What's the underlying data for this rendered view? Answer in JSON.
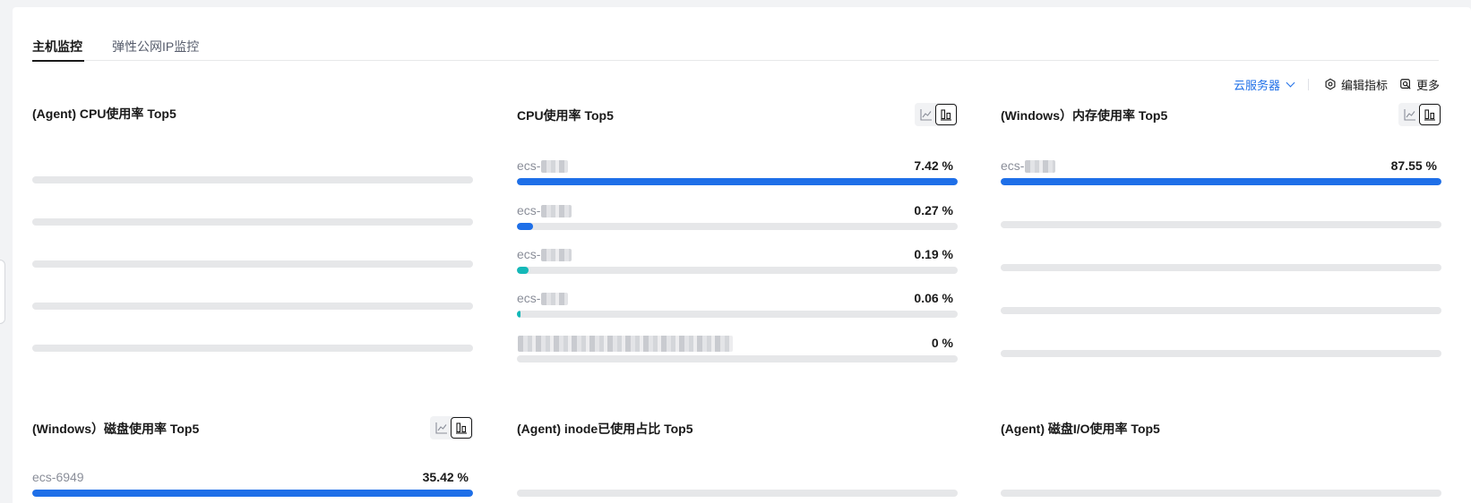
{
  "tabs": [
    {
      "label": "主机监控",
      "active": true
    },
    {
      "label": "弹性公网IP监控",
      "active": false
    }
  ],
  "toolbar": {
    "server_select": "云服务器",
    "edit_metrics": "编辑指标",
    "more": "更多"
  },
  "panels": {
    "agent_cpu": {
      "title": "(Agent) CPU使用率 Top5"
    },
    "cpu": {
      "title": "CPU使用率 Top5",
      "rows": [
        {
          "name": "ecs-",
          "value": "7.42 %",
          "fill_fraction": 1.0,
          "color": "#1e6fe8"
        },
        {
          "name": "ecs-",
          "value": "0.27 %",
          "fill_fraction": 0.036,
          "color": "#1e6fe8"
        },
        {
          "name": "ecs-",
          "value": "0.19 %",
          "fill_fraction": 0.026,
          "color": "#14b8b8"
        },
        {
          "name": "ecs-",
          "value": "0.06 %",
          "fill_fraction": 0.008,
          "color": "#14b8b8"
        },
        {
          "name": "",
          "value": "0 %",
          "fill_fraction": 0,
          "color": "#14b8b8"
        }
      ]
    },
    "win_mem": {
      "title": "(Windows）内存使用率 Top5",
      "rows": [
        {
          "name": "ecs-",
          "value": "87.55 %",
          "fill_fraction": 1.0,
          "color": "#1e6fe8"
        }
      ]
    },
    "win_disk": {
      "title": "(Windows）磁盘使用率 Top5",
      "rows": [
        {
          "name": "ecs-6949",
          "value": "35.42 %",
          "fill_fraction": 1.0,
          "color": "#1e6fe8"
        }
      ]
    },
    "agent_inode": {
      "title": "(Agent) inode已使用占比 Top5"
    },
    "agent_disk_io": {
      "title": "(Agent) 磁盘I/O使用率 Top5"
    }
  },
  "colors": {
    "accent": "#1e6fe8",
    "teal": "#14b8b8",
    "track": "#e6e7e9"
  },
  "icons": [
    "chevron-down-icon",
    "gear-icon",
    "search-icon",
    "line-chart-icon",
    "bar-chart-icon"
  ]
}
